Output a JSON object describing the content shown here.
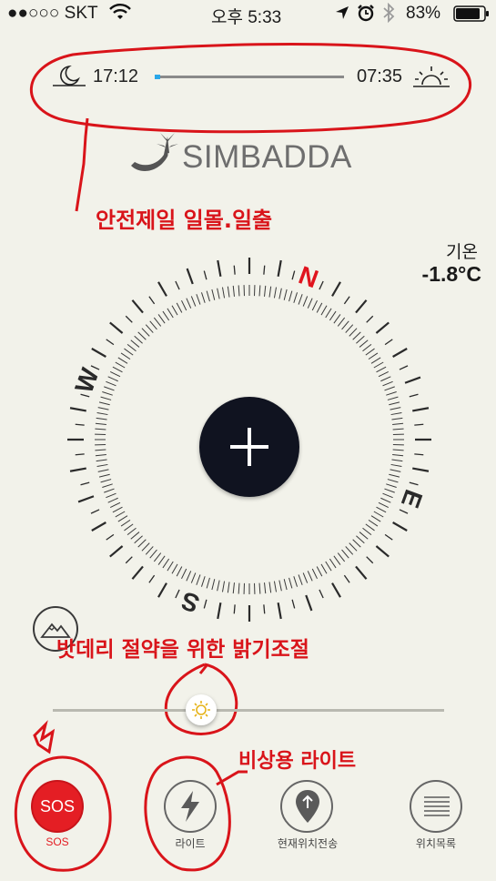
{
  "status_bar": {
    "carrier": "●●○○○ SKT",
    "time": "오후 5:33",
    "battery": "83%",
    "icons": [
      "wifi-icon",
      "location-arrow-icon",
      "alarm-icon",
      "bluetooth-icon",
      "battery-icon"
    ]
  },
  "sun": {
    "sunset": "17:12",
    "sunrise": "07:35",
    "progress": 0.03,
    "icons": [
      "moon-icon",
      "sunrise-icon"
    ]
  },
  "logo": {
    "text": "SIMBADDA"
  },
  "temperature": {
    "label": "기온",
    "value": "-1.8°C"
  },
  "compass": {
    "north": "N",
    "east": "E",
    "south": "S",
    "west": "W",
    "heading_deg": 20,
    "north_color": "#e0141e"
  },
  "annotations": {
    "sun": "안전제일 일몰.일출",
    "battery": "밧데리 절약을 위한 밝기조절",
    "light": "비상용 라이트"
  },
  "brightness": {
    "level": 0.38
  },
  "bottom_nav": {
    "sos_button_text": "SOS",
    "sos_label": "SOS",
    "light_label": "라이트",
    "send_location_label": "현재위치전송",
    "location_list_label": "위치목록"
  },
  "colors": {
    "background": "#f2f2ea",
    "accent": "#e0141e",
    "annotation": "#d9141a"
  }
}
